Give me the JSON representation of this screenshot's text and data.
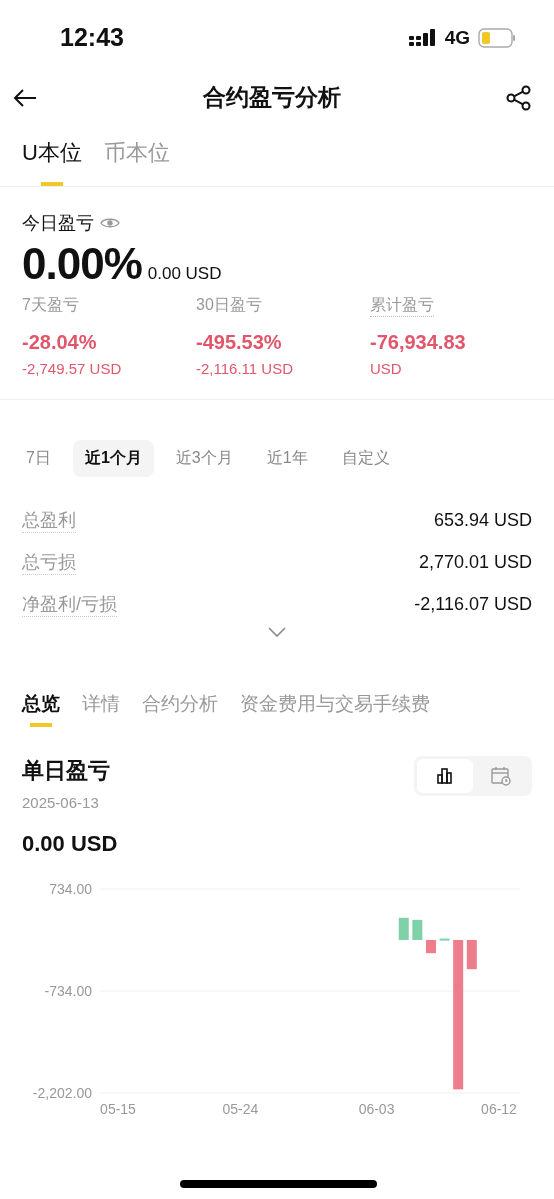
{
  "status_bar": {
    "time": "12:43",
    "network": "4G"
  },
  "header": {
    "title": "合约盈亏分析"
  },
  "account_tabs": [
    {
      "label": "U本位",
      "selected": true
    },
    {
      "label": "币本位",
      "selected": false
    }
  ],
  "today": {
    "label": "今日盈亏",
    "percent": "0.00%",
    "amount": "0.00 USD"
  },
  "stats": [
    {
      "label": "7天盈亏",
      "underlined": false,
      "value": "-28.04%",
      "sub": "-2,749.57 USD"
    },
    {
      "label": "30日盈亏",
      "underlined": false,
      "value": "-495.53%",
      "sub": "-2,116.11 USD"
    },
    {
      "label": "累计盈亏",
      "underlined": true,
      "value": "-76,934.83",
      "sub": "USD"
    }
  ],
  "periods": [
    {
      "label": "7日",
      "selected": false
    },
    {
      "label": "近1个月",
      "selected": true
    },
    {
      "label": "近3个月",
      "selected": false
    },
    {
      "label": "近1年",
      "selected": false
    },
    {
      "label": "自定义",
      "selected": false
    }
  ],
  "summary": [
    {
      "label": "总盈利",
      "value": "653.94 USD"
    },
    {
      "label": "总亏损",
      "value": "2,770.01 USD"
    },
    {
      "label": "净盈利/亏损",
      "value": "-2,116.07 USD"
    }
  ],
  "section_tabs": [
    {
      "label": "总览",
      "selected": true
    },
    {
      "label": "详情",
      "selected": false
    },
    {
      "label": "合约分析",
      "selected": false
    },
    {
      "label": "资金费用与交易手续费",
      "selected": false
    }
  ],
  "daily": {
    "title": "单日盈亏",
    "date": "2025-06-13",
    "amount": "0.00 USD",
    "view_toggle": [
      {
        "kind": "bar-chart",
        "selected": true
      },
      {
        "kind": "calendar",
        "selected": false
      }
    ],
    "chart_data": {
      "type": "bar",
      "categories": [
        "05-15",
        null,
        null,
        null,
        null,
        null,
        null,
        null,
        null,
        "05-24",
        null,
        null,
        null,
        null,
        null,
        null,
        null,
        null,
        null,
        "06-03",
        null,
        null,
        null,
        null,
        null,
        null,
        null,
        null,
        "06-12"
      ],
      "values": [
        null,
        null,
        null,
        null,
        null,
        null,
        null,
        null,
        null,
        null,
        null,
        null,
        null,
        null,
        null,
        null,
        null,
        null,
        null,
        null,
        null,
        320,
        290,
        -190,
        20,
        -2150,
        -420,
        null,
        null
      ],
      "ylim": [
        -2202,
        734
      ],
      "yticks": [
        {
          "value": 734,
          "label": "734.00"
        },
        {
          "value": -734,
          "label": "-734.00"
        },
        {
          "value": -2202,
          "label": "-2,202.00"
        }
      ]
    }
  }
}
